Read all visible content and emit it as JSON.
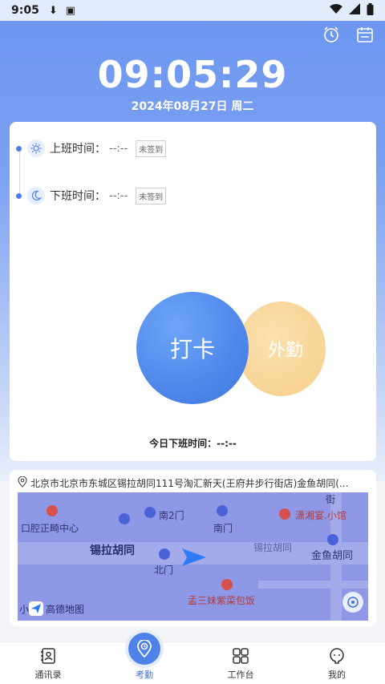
{
  "status_bar": {
    "time": "9:05"
  },
  "header": {
    "clock": "09:05:29",
    "date": "2024年08月27日 周二"
  },
  "attendance": {
    "on_duty": {
      "label": "上班时间：",
      "value": "--:--",
      "badge": "未签到"
    },
    "off_duty": {
      "label": "下班时间：",
      "value": "--:--",
      "badge": "未签到"
    },
    "punch_label": "打卡",
    "outwork_label": "外勤",
    "today_off_label": "今日下班时间：",
    "today_off_value": "--:--"
  },
  "location": {
    "address": "北京市北京市东城区锡拉胡同111号淘汇新天(王府井步行街店)金鱼胡同(..."
  },
  "map": {
    "labels": {
      "nan2men": "南2门",
      "kouqiang": "口腔正畸中心",
      "nanmen": "南门",
      "xiaoxiang": "潇湘宴.小馆",
      "xila": "锡拉胡同",
      "xila_right": "锡拉胡同",
      "jieyu": "金鱼胡同",
      "beimen": "北门",
      "mengsan": "孟三妹紫菜包饭",
      "jie": "街",
      "xiao": "小",
      "gaode": "高德地图"
    }
  },
  "nav": {
    "items": [
      {
        "label": "通讯录"
      },
      {
        "label": "考勤"
      },
      {
        "label": "工作台"
      },
      {
        "label": "我的"
      }
    ]
  }
}
